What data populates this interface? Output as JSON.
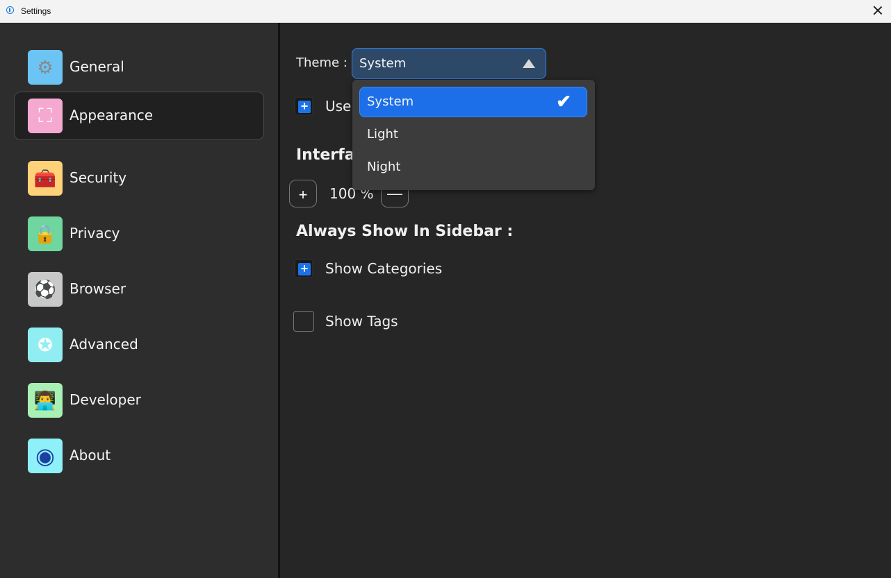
{
  "window": {
    "title": "Settings"
  },
  "sidebar": {
    "items": [
      {
        "label": "General",
        "icon": "gear-icon",
        "bg": "#6cc4f4",
        "glyph": "⚙"
      },
      {
        "label": "Appearance",
        "icon": "frame-icon",
        "bg": "#f5a8d0",
        "glyph": "⛶"
      },
      {
        "label": "Security",
        "icon": "toolbox-icon",
        "bg": "#ffd27a",
        "glyph": "🧰"
      },
      {
        "label": "Privacy",
        "icon": "lock-icon",
        "bg": "#6fd6a0",
        "glyph": "🔒"
      },
      {
        "label": "Browser",
        "icon": "globe-icon",
        "bg": "#c8c8c8",
        "glyph": "⚽"
      },
      {
        "label": "Advanced",
        "icon": "star-icon",
        "bg": "#90eef2",
        "glyph": "✪"
      },
      {
        "label": "Developer",
        "icon": "developer-icon",
        "bg": "#a9f0b4",
        "glyph": "👨‍💻"
      },
      {
        "label": "About",
        "icon": "eye-icon",
        "bg": "#8ef0f8",
        "glyph": "◉"
      }
    ],
    "active_index": 1
  },
  "appearance": {
    "theme_label": "Theme :",
    "theme_value": "System",
    "use_label": "Use",
    "interface_label": "Interface",
    "zoom_plus": "+",
    "zoom_minus": "—",
    "zoom_value": "100 %",
    "sidebar_heading": "Always Show In Sidebar :",
    "show_categories": "Show Categories",
    "show_categories_checked": true,
    "show_tags": "Show Tags",
    "show_tags_checked": false
  },
  "theme_dropdown": {
    "options": [
      "System",
      "Light",
      "Night"
    ],
    "selected": "System",
    "check_glyph": "✔"
  },
  "colors": {
    "accent": "#1c73e8",
    "sidebar_bg": "#2d2d2d",
    "content_bg": "#262626"
  }
}
